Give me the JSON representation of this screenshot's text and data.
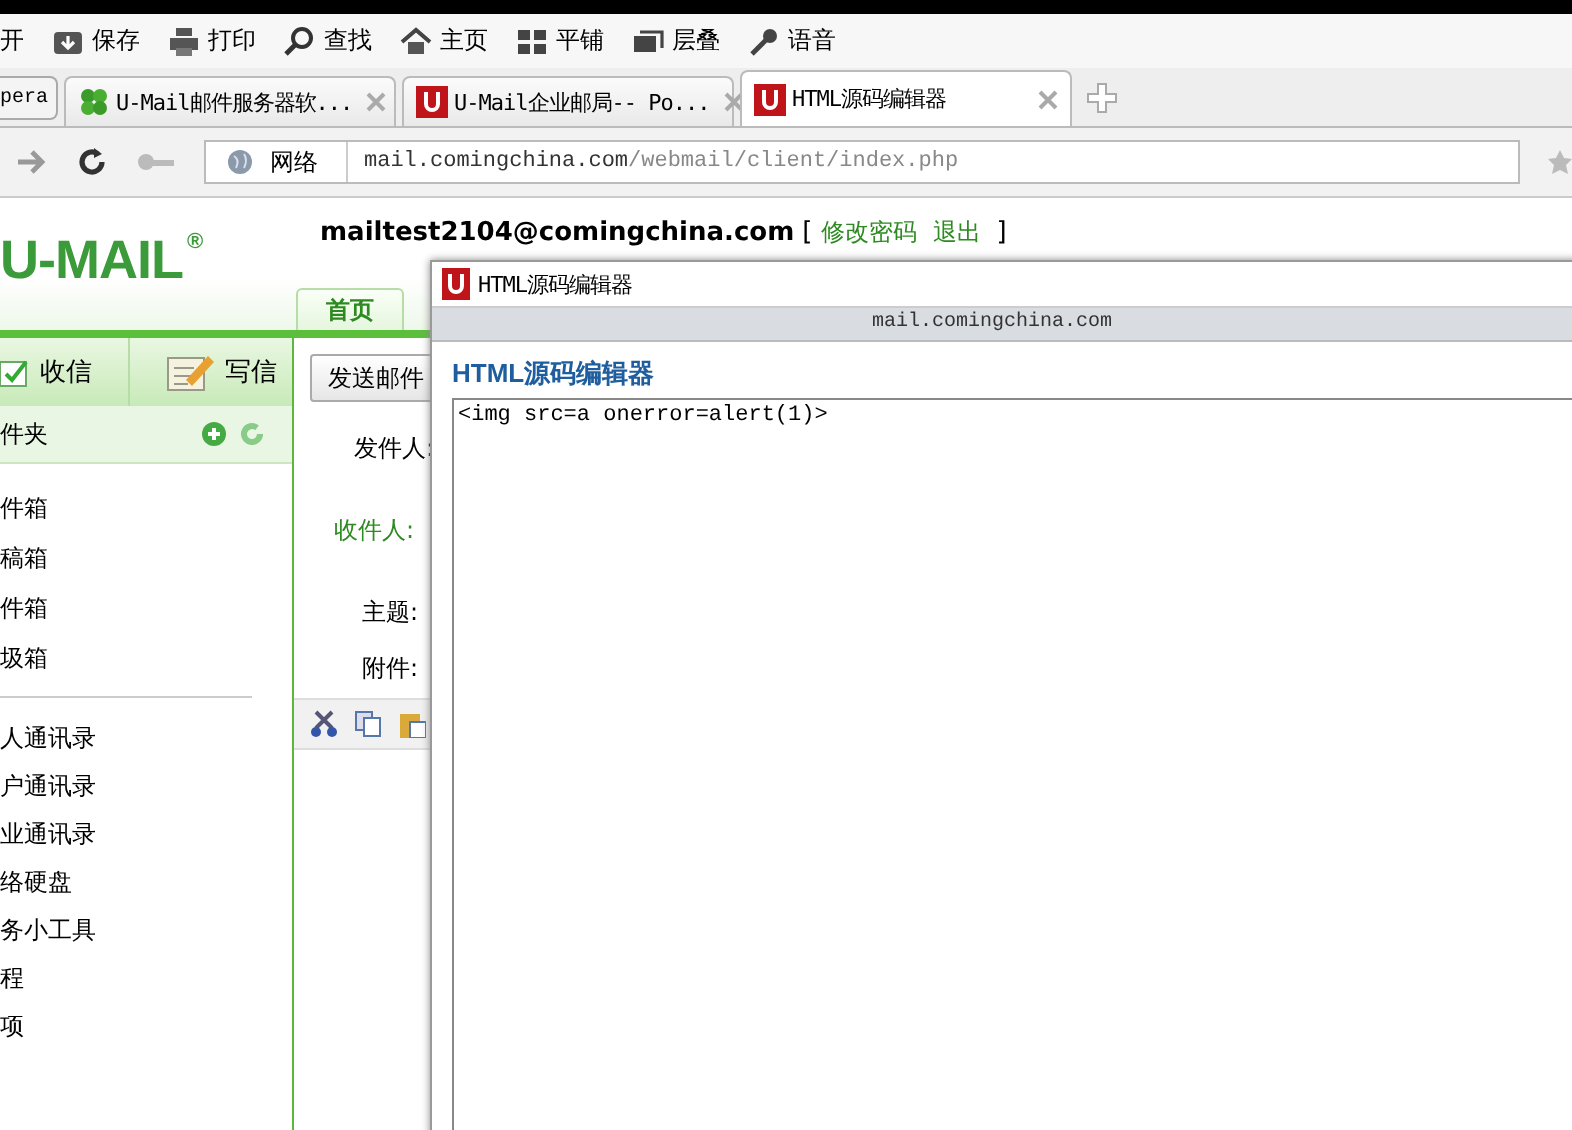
{
  "browser_toolbar": [
    {
      "label": "开"
    },
    {
      "label": "保存"
    },
    {
      "label": "打印"
    },
    {
      "label": "查找"
    },
    {
      "label": "主页"
    },
    {
      "label": "平铺"
    },
    {
      "label": "层叠"
    },
    {
      "label": "语音"
    }
  ],
  "menu_button": {
    "label": "pera"
  },
  "tabs": [
    {
      "label": "U-Mail邮件服务器软...",
      "kind": "clover",
      "selected": false
    },
    {
      "label": "U-Mail企业邮局-- Po...",
      "kind": "umail",
      "selected": false
    },
    {
      "label": "HTML源码编辑器",
      "kind": "umail",
      "selected": true
    }
  ],
  "address_bar": {
    "zone": "网络",
    "host": "mail.comingchina.com",
    "path": "/webmail/client/index.php"
  },
  "header": {
    "logo": "U-MAIL",
    "logo_mark": "®",
    "email": "mailtest2104@comingchina.com",
    "bracket_open": "[",
    "links": [
      "修改密码",
      "退出"
    ],
    "bracket_close": "]"
  },
  "nav_tabs": [
    {
      "label": "首页"
    }
  ],
  "sidebar": {
    "actions": [
      "收信",
      "写信"
    ],
    "folders_title": "件夹",
    "folders": [
      "件箱",
      "稿箱",
      "件箱",
      "圾箱"
    ],
    "tools": [
      "人通讯录",
      "户通讯录",
      "业通讯录",
      "络硬盘",
      "务小工具",
      "程",
      "项"
    ]
  },
  "compose": {
    "send_button": "发送邮件",
    "fields": [
      "发件人:",
      "收件人:",
      "主题:",
      "附件:"
    ]
  },
  "dialog": {
    "title": "HTML源码编辑器",
    "host": "mail.comingchina.com",
    "heading": "HTML源码编辑器",
    "code": "<img src=a onerror=alert(1)>"
  }
}
